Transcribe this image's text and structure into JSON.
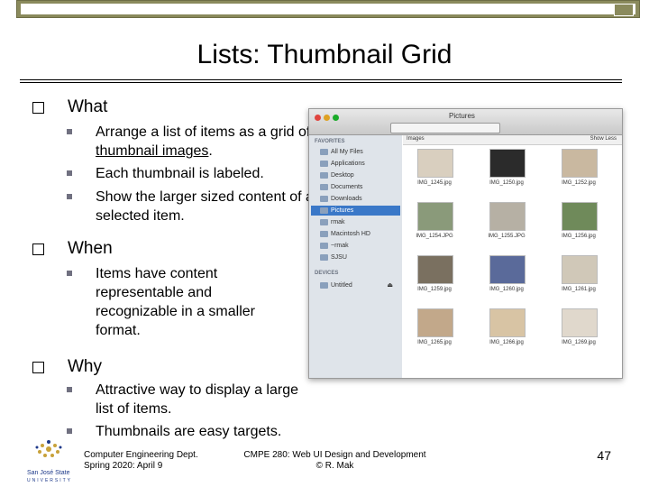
{
  "slide": {
    "title": "Lists: Thumbnail Grid",
    "page_number": "47"
  },
  "bullets": [
    {
      "label": "What",
      "subs": [
        {
          "pre": "Arrange a list of items as a grid of ",
          "u": "thumbnail images",
          "post": "."
        },
        {
          "text": "Each thumbnail is labeled."
        },
        {
          "text": "Show the larger sized content of a selected item."
        }
      ]
    },
    {
      "label": "When",
      "subs": [
        {
          "text": "Items have content representable and recognizable in a smaller format."
        }
      ]
    },
    {
      "label": "Why",
      "subs": [
        {
          "text": "Attractive way to display a large list of items."
        },
        {
          "text": "Thumbnails are easy targets."
        }
      ]
    }
  ],
  "footer": {
    "left_line1": "Computer Engineering Dept.",
    "left_line2": "Spring 2020: April 9",
    "mid_line1": "CMPE 280: Web UI Design and Development",
    "mid_line2": "© R. Mak"
  },
  "logo": {
    "text_line1": "San José State",
    "text_line2": "UNIVERSITY"
  },
  "finder": {
    "window_title": "Pictures",
    "column_header": "Images",
    "column_header_right": "Show Less",
    "favorites_header": "FAVORITES",
    "devices_header": "DEVICES",
    "sidebar": [
      {
        "label": "All My Files",
        "selected": false
      },
      {
        "label": "Applications",
        "selected": false
      },
      {
        "label": "Desktop",
        "selected": false
      },
      {
        "label": "Documents",
        "selected": false
      },
      {
        "label": "Downloads",
        "selected": false
      },
      {
        "label": "Pictures",
        "selected": true
      },
      {
        "label": "rmak",
        "selected": false
      },
      {
        "label": "Macintosh HD",
        "selected": false
      },
      {
        "label": "~rmak",
        "selected": false
      },
      {
        "label": "SJSU",
        "selected": false
      }
    ],
    "device": "Untitled",
    "thumbnails": [
      "IMG_1245.jpg",
      "IMG_1250.jpg",
      "IMG_1252.jpg",
      "IMG_1254.JPG",
      "IMG_1255.JPG",
      "IMG_1256.jpg",
      "IMG_1259.jpg",
      "IMG_1260.jpg",
      "IMG_1261.jpg",
      "IMG_1265.jpg",
      "IMG_1266.jpg",
      "IMG_1269.jpg"
    ]
  }
}
